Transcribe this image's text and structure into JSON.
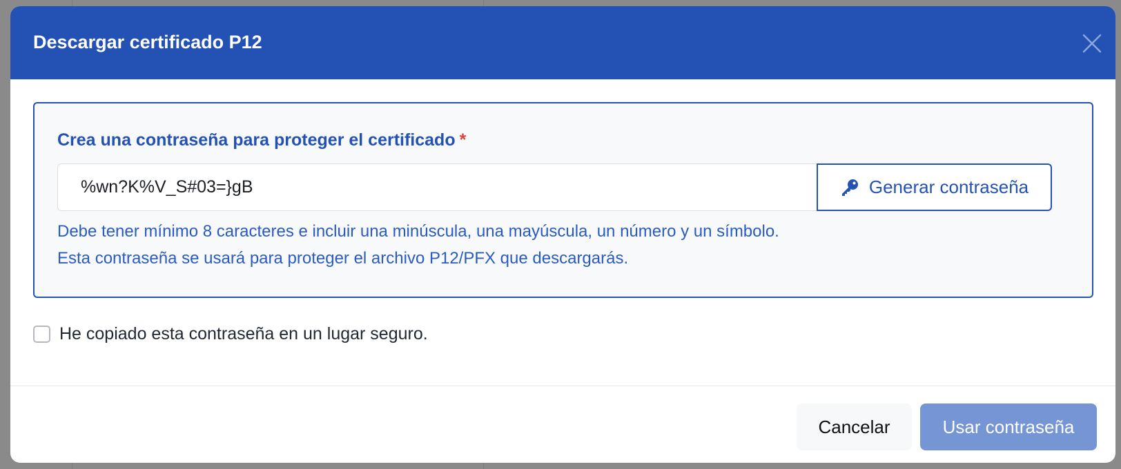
{
  "modal": {
    "title": "Descargar certificado P12",
    "close_icon": "close-icon"
  },
  "password_section": {
    "label": "Crea una contraseña para proteger el certificado",
    "required_marker": "*",
    "password_value": "%wn?K%V_S#03=}gB",
    "generate_button_label": "Generar contraseña",
    "generate_icon": "key-icon",
    "hint_line1": "Debe tener mínimo 8 caracteres e incluir una minúscula, una mayúscula, un número y un símbolo.",
    "hint_line2": "Esta contraseña se usará para proteger el archivo P12/PFX que descargarás."
  },
  "confirm": {
    "label": "He copiado esta contraseña en un lugar seguro.",
    "checked": false
  },
  "footer": {
    "cancel_label": "Cancelar",
    "use_label": "Usar contraseña"
  },
  "colors": {
    "header_bg": "#2452b4",
    "accent": "#2452b4",
    "required": "#d9463c",
    "primary_disabled": "#7595d4"
  }
}
